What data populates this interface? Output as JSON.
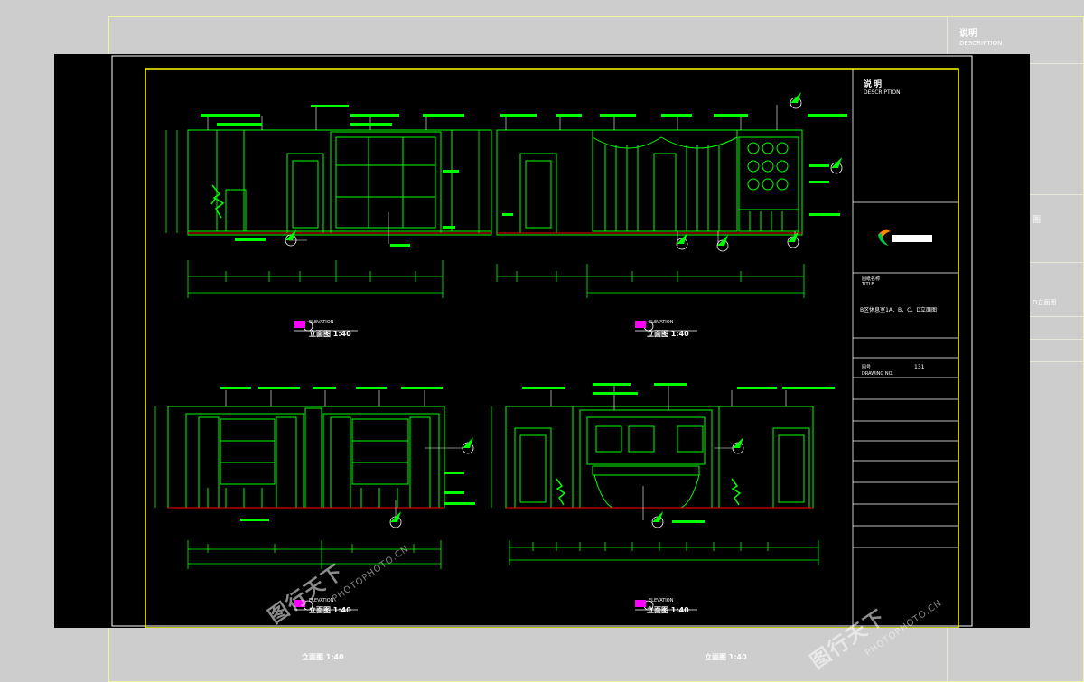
{
  "sheet": {
    "description_cn": "说明",
    "description_en": "DESCRIPTION",
    "title_label_cn": "图纸名称",
    "title_label_en": "TITLE",
    "title_value": "B区休息室1A、B、C、D立面图",
    "drawing_no_label_cn": "图号",
    "drawing_no_label_en": "DRAWING NO.",
    "drawing_no_value": "131"
  },
  "elevations": [
    {
      "tag": "ELEVATION",
      "scale_text": "立面图 1:40"
    },
    {
      "tag": "ELEVATION",
      "scale_text": "立面图 1:40"
    },
    {
      "tag": "ELEVATION",
      "scale_text": "立面图 1:40"
    },
    {
      "tag": "ELEVATION",
      "scale_text": "立面图 1:40"
    }
  ],
  "background_sheet": {
    "description_cn": "说明",
    "description_en": "DESCRIPTION",
    "scale_left": "立面图 1:40",
    "scale_right": "立面图 1:40",
    "side_text_1": "图",
    "side_text_2": "D立面图"
  },
  "watermark": {
    "text": "图行天下",
    "site": "PHOTOPHOTO.CN"
  },
  "colors": {
    "line_green": "#00ff00",
    "frame_yellow": "#ffff00",
    "dim_cyan": "#00ffff",
    "cad_black": "#000000",
    "text_white": "#ffffff",
    "level_magenta": "#ff00ff"
  }
}
